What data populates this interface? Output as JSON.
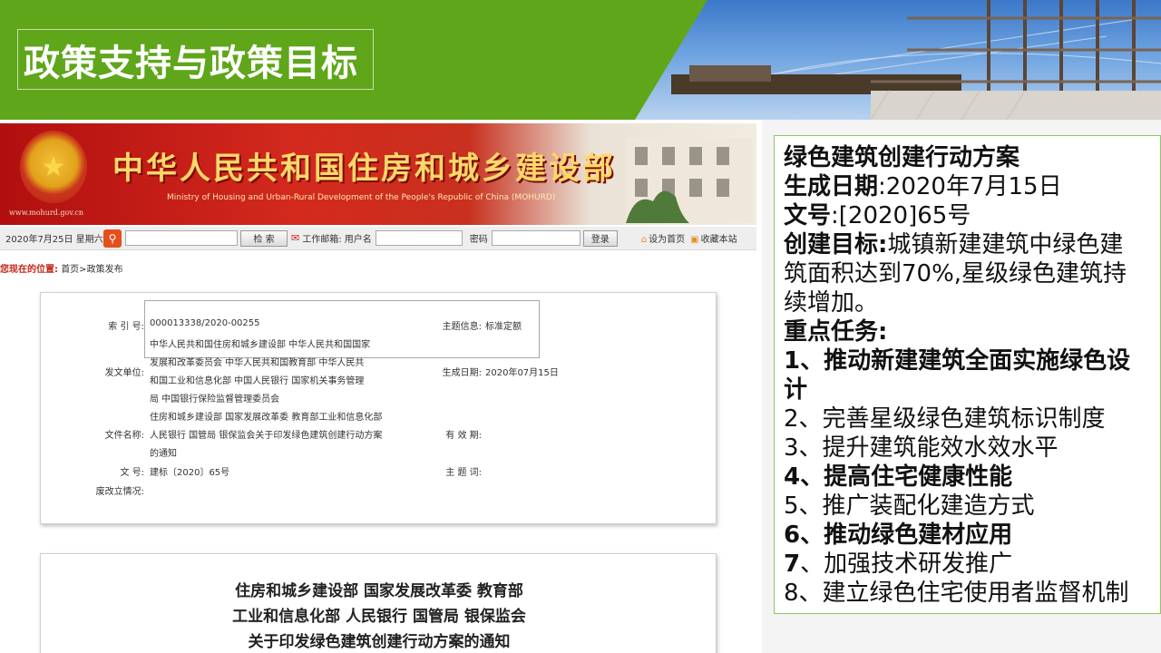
{
  "slide": {
    "title": "政策支持与政策目标"
  },
  "site": {
    "name_cn": "中华人民共和国住房和城乡建设部",
    "name_en": "Ministry of Housing and Urban-Rural Development of the People's Republic of China (MOHURD)",
    "url": "www.mohurd.gov.cn",
    "toolbar": {
      "date": "2020年7月25日 星期六",
      "search_button": "检 索",
      "mail_label": "工作邮箱: 用户名",
      "password_label": "密码",
      "login_button": "登录",
      "set_home": "设为首页",
      "bookmark": "收藏本站"
    },
    "breadcrumb": {
      "label": "您现在的位置:",
      "path": "首页>政策发布"
    },
    "info": {
      "index_label": "索 引 号:",
      "index_value": "000013338/2020-00255",
      "topic_label": "主题信息:",
      "topic_value": "标准定额",
      "issuer_label": "发文单位:",
      "issuer_lines": [
        "中华人民共和国住房和城乡建设部   中华人民共和国国家",
        "发展和改革委员会   中华人民共和国教育部   中华人民共",
        "和国工业和信息化部   中国人民银行   国家机关事务管理",
        "局   中国银行保险监督管理委员会",
        "住房和城乡建设部 国家发展改革委 教育部工业和信息化部"
      ],
      "date_label": "生成日期:",
      "date_value": "2020年07月15日",
      "filename_label": "文件名称:",
      "filename_lines": [
        "人民银行 国管局 银保监会关于印发绿色建筑创建行动方案",
        "的通知"
      ],
      "validity_label": "有 效 期:",
      "docno_label": "文       号:",
      "docno_value": "建标〔2020〕65号",
      "keywords_label": "主 题 词:",
      "status_label": "废改立情况:"
    },
    "notice_lines": [
      "住房和城乡建设部 国家发展改革委 教育部",
      "工业和信息化部 人民银行 国管局 银保监会",
      "关于印发绿色建筑创建行动方案的通知"
    ]
  },
  "panel": {
    "heading": "绿色建筑创建行动方案",
    "date_label": "生成日期",
    "date_value": ":2020年7月15日",
    "docno_label": "文号",
    "docno_value": ":[2020]65号",
    "goal_label": "创建目标:",
    "goal_text_1": "城镇新建建筑中绿色建",
    "goal_text_2": "筑面积达到70%,星级绿色建筑持",
    "goal_text_3": "续增加。",
    "tasks_label": "重点任务:",
    "task_1a": "1、推动新建建筑全面实施绿色设",
    "task_1b": "计",
    "task_2": "2、完善星级绿色建筑标识制度",
    "task_3": "3、提升建筑能效水效水平",
    "task_4": "4、提高住宅健康性能",
    "task_5": "5、推广装配化建造方式",
    "task_6": "6、推动绿色建材应用",
    "task_7_num": "7",
    "task_7_text": "、加强技术研发推广",
    "task_8": "8、建立绿色住宅使用者监督机制"
  }
}
